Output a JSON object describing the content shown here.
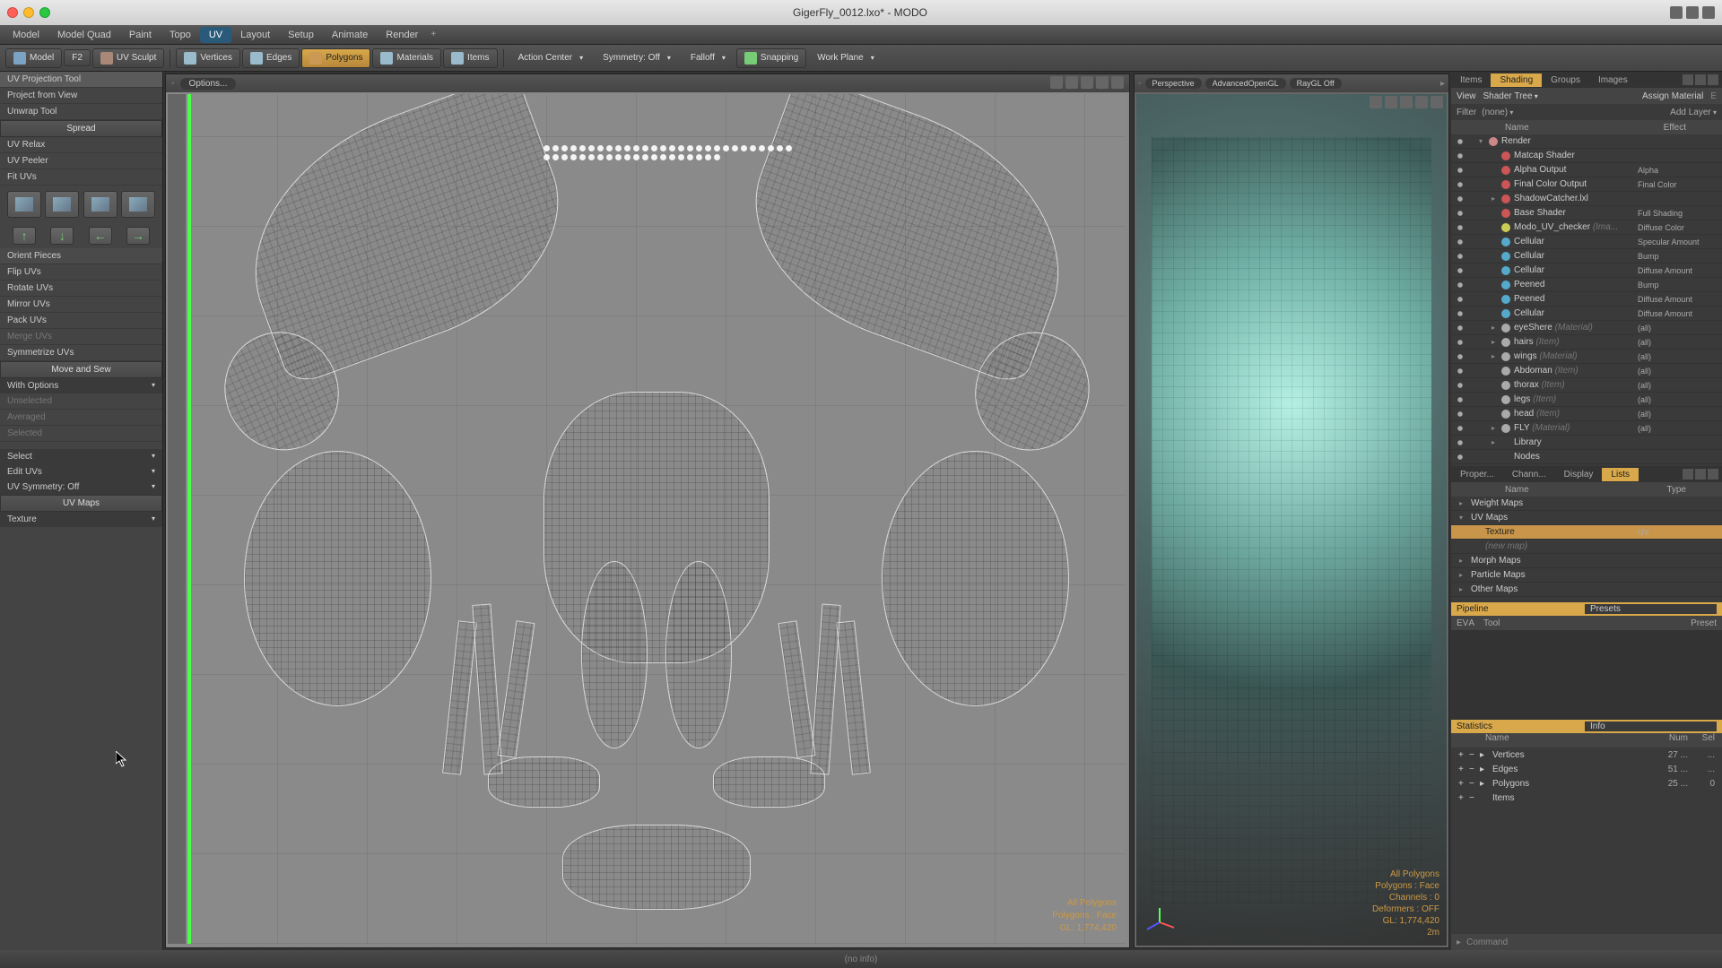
{
  "window": {
    "title": "GigerFly_0012.lxo* - MODO"
  },
  "menubar": [
    "Model",
    "Model Quad",
    "Paint",
    "Topo",
    "UV",
    "Layout",
    "Setup",
    "Animate",
    "Render"
  ],
  "menubar_active": 4,
  "toolbar": {
    "mode": "Model",
    "mode2": "F2",
    "uvsculpt": "UV Sculpt",
    "components": [
      "Vertices",
      "Edges",
      "Polygons",
      "Materials",
      "Items"
    ],
    "component_active": 2,
    "action_center": "Action Center",
    "symmetry": "Symmetry: Off",
    "falloff": "Falloff",
    "snapping": "Snapping",
    "workplane": "Work Plane"
  },
  "left_panel": {
    "proj_tool": "UV Projection Tool",
    "proj_view": "Project from View",
    "unwrap": "Unwrap Tool",
    "spread": "Spread",
    "uv_relax": "UV Relax",
    "uv_peeler": "UV Peeler",
    "fit_uvs": "Fit UVs",
    "orient": "Orient Pieces",
    "flip": "Flip UVs",
    "rotate": "Rotate UVs",
    "mirror": "Mirror UVs",
    "pack": "Pack UVs",
    "merge": "Merge UVs",
    "symmetrize": "Symmetrize UVs",
    "move_sew": "Move and Sew",
    "with_options": "With Options",
    "unselected": "Unselected",
    "averaged": "Averaged",
    "selected": "Selected",
    "select": "Select",
    "edit": "Edit UVs",
    "uv_sym": "UV Symmetry: Off",
    "uv_maps": "UV Maps",
    "texture": "Texture"
  },
  "uv_view": {
    "options": "Options...",
    "overlay": {
      "l1": "All Polygons",
      "l2": "Polygons : Face",
      "l3": "GL: 1,774,420"
    }
  },
  "persp_view": {
    "modes": [
      "Perspective",
      "AdvancedOpenGL",
      "RayGL Off"
    ],
    "overlay": {
      "l1": "All Polygons",
      "l2": "Polygons : Face",
      "l3": "Channels : 0",
      "l4": "Deformers : OFF",
      "l5": "GL: 1,774,420",
      "l6": "2m"
    }
  },
  "shading": {
    "tabs": [
      "Items",
      "Shading",
      "Groups",
      "Images"
    ],
    "tabs_active": 1,
    "view": "View",
    "shader_tree": "Shader Tree",
    "assign": "Assign Material",
    "filter": "Filter",
    "filter_val": "(none)",
    "add_layer": "Add Layer",
    "col_name": "Name",
    "col_effect": "Effect",
    "rows": [
      {
        "indent": 0,
        "arrow": "▾",
        "dot": "#c88",
        "name": "Render",
        "effect": ""
      },
      {
        "indent": 1,
        "arrow": "",
        "dot": "#c55",
        "name": "Matcap Shader",
        "effect": ""
      },
      {
        "indent": 1,
        "arrow": "",
        "dot": "#c55",
        "name": "Alpha Output",
        "effect": "Alpha"
      },
      {
        "indent": 1,
        "arrow": "",
        "dot": "#c55",
        "name": "Final Color Output",
        "effect": "Final Color"
      },
      {
        "indent": 1,
        "arrow": "▸",
        "dot": "#c55",
        "name": "ShadowCatcher.lxl",
        "effect": ""
      },
      {
        "indent": 1,
        "arrow": "",
        "dot": "#c55",
        "name": "Base Shader",
        "effect": "Full Shading"
      },
      {
        "indent": 1,
        "arrow": "",
        "dot": "#cc5",
        "name": "Modo_UV_checker",
        "dim": "(Ima...",
        "effect": "Diffuse Color"
      },
      {
        "indent": 1,
        "arrow": "",
        "dot": "#5ac",
        "name": "Cellular",
        "effect": "Specular Amount"
      },
      {
        "indent": 1,
        "arrow": "",
        "dot": "#5ac",
        "name": "Cellular",
        "effect": "Bump"
      },
      {
        "indent": 1,
        "arrow": "",
        "dot": "#5ac",
        "name": "Cellular",
        "effect": "Diffuse Amount"
      },
      {
        "indent": 1,
        "arrow": "",
        "dot": "#5ac",
        "name": "Peened",
        "effect": "Bump"
      },
      {
        "indent": 1,
        "arrow": "",
        "dot": "#5ac",
        "name": "Peened",
        "effect": "Diffuse Amount"
      },
      {
        "indent": 1,
        "arrow": "",
        "dot": "#5ac",
        "name": "Cellular",
        "effect": "Diffuse Amount"
      },
      {
        "indent": 1,
        "arrow": "▸",
        "dot": "#aaa",
        "name": "eyeShere",
        "dim": "(Material)",
        "effect": "(all)"
      },
      {
        "indent": 1,
        "arrow": "▸",
        "dot": "#aaa",
        "name": "hairs",
        "dim": "(Item)",
        "effect": "(all)"
      },
      {
        "indent": 1,
        "arrow": "▸",
        "dot": "#aaa",
        "name": "wings",
        "dim": "(Material)",
        "effect": "(all)"
      },
      {
        "indent": 1,
        "arrow": "",
        "dot": "#aaa",
        "name": "Abdoman",
        "dim": "(Item)",
        "effect": "(all)"
      },
      {
        "indent": 1,
        "arrow": "",
        "dot": "#aaa",
        "name": "thorax",
        "dim": "(Item)",
        "effect": "(all)"
      },
      {
        "indent": 1,
        "arrow": "",
        "dot": "#aaa",
        "name": "legs",
        "dim": "(Item)",
        "effect": "(all)"
      },
      {
        "indent": 1,
        "arrow": "",
        "dot": "#aaa",
        "name": "head",
        "dim": "(Item)",
        "effect": "(all)"
      },
      {
        "indent": 1,
        "arrow": "▸",
        "dot": "#aaa",
        "name": "FLY",
        "dim": "(Material)",
        "effect": "(all)"
      },
      {
        "indent": 1,
        "arrow": "▸",
        "dot": "",
        "name": "Library",
        "effect": ""
      },
      {
        "indent": 1,
        "arrow": "",
        "dot": "",
        "name": "Nodes",
        "effect": ""
      }
    ]
  },
  "lists": {
    "tabs": [
      "Proper...",
      "Chann...",
      "Display",
      "Lists"
    ],
    "tabs_active": 3,
    "col_name": "Name",
    "col_type": "Type",
    "rows": [
      {
        "arrow": "▸",
        "name": "Weight Maps",
        "type": ""
      },
      {
        "arrow": "▾",
        "name": "UV Maps",
        "type": ""
      },
      {
        "arrow": "",
        "name": "Texture",
        "type": "UV",
        "indent": true,
        "hl": true
      },
      {
        "arrow": "",
        "name": "(new map)",
        "type": "",
        "indent": true,
        "dim": true
      },
      {
        "arrow": "▸",
        "name": "Morph Maps",
        "type": ""
      },
      {
        "arrow": "▸",
        "name": "Particle Maps",
        "type": ""
      },
      {
        "arrow": "▸",
        "name": "Other Maps",
        "type": ""
      }
    ]
  },
  "pipeline": {
    "tab1": "Pipeline",
    "tab2": "Presets",
    "cols": [
      "E",
      "V",
      "A",
      "Tool",
      "Preset"
    ]
  },
  "stats": {
    "tab1": "Statistics",
    "tab2": "Info",
    "col_name": "Name",
    "col_num": "Num",
    "col_sel": "Sel",
    "rows": [
      {
        "arrow": "▸",
        "name": "Vertices",
        "num": "27 ...",
        "sel": "...",
        "dim": true
      },
      {
        "arrow": "▸",
        "name": "Edges",
        "num": "51 ...",
        "sel": "..."
      },
      {
        "arrow": "▸",
        "name": "Polygons",
        "num": "25 ...",
        "sel": "0"
      },
      {
        "arrow": "",
        "name": "Items",
        "num": "",
        "sel": "",
        "dim": true
      }
    ]
  },
  "command": "Command",
  "footer": "(no info)"
}
